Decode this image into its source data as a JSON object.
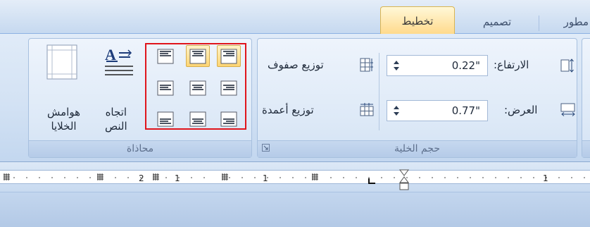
{
  "tabs": {
    "layout": "تخطيط",
    "design": "تصميم",
    "developer": "مطور"
  },
  "cell_size_group": {
    "label": "حجم الخلية",
    "height_label": "الارتفاع:",
    "height_value": "0.22\"",
    "width_label": "العرض:",
    "width_value": "0.77\"",
    "distribute_rows": "توزيع صفوف",
    "distribute_columns": "توزيع أعمدة"
  },
  "alignment_group": {
    "label": "محاذاة",
    "text_direction": "اتجاه\nالنص",
    "cell_margins": "هوامش\nالخلايا"
  },
  "ruler": {
    "numbers": [
      "2",
      "1",
      "1",
      "1"
    ]
  },
  "icons": [
    "dialog-launcher-icon",
    "row-height-icon",
    "column-width-icon",
    "distribute-rows-icon",
    "distribute-columns-icon",
    "text-direction-icon",
    "cell-margins-icon",
    "align-top-right-icon",
    "align-top-center-icon",
    "align-top-left-icon",
    "align-middle-right-icon",
    "align-middle-center-icon",
    "align-middle-left-icon",
    "align-bottom-right-icon",
    "align-bottom-center-icon",
    "align-bottom-left-icon",
    "tab-stop-icon",
    "indent-marker-icon"
  ],
  "colors": {
    "active_tab": "#ffd98a",
    "highlight": "#ffd572",
    "selection_box": "#e0151c",
    "ribbon": "#d3e2f4"
  }
}
